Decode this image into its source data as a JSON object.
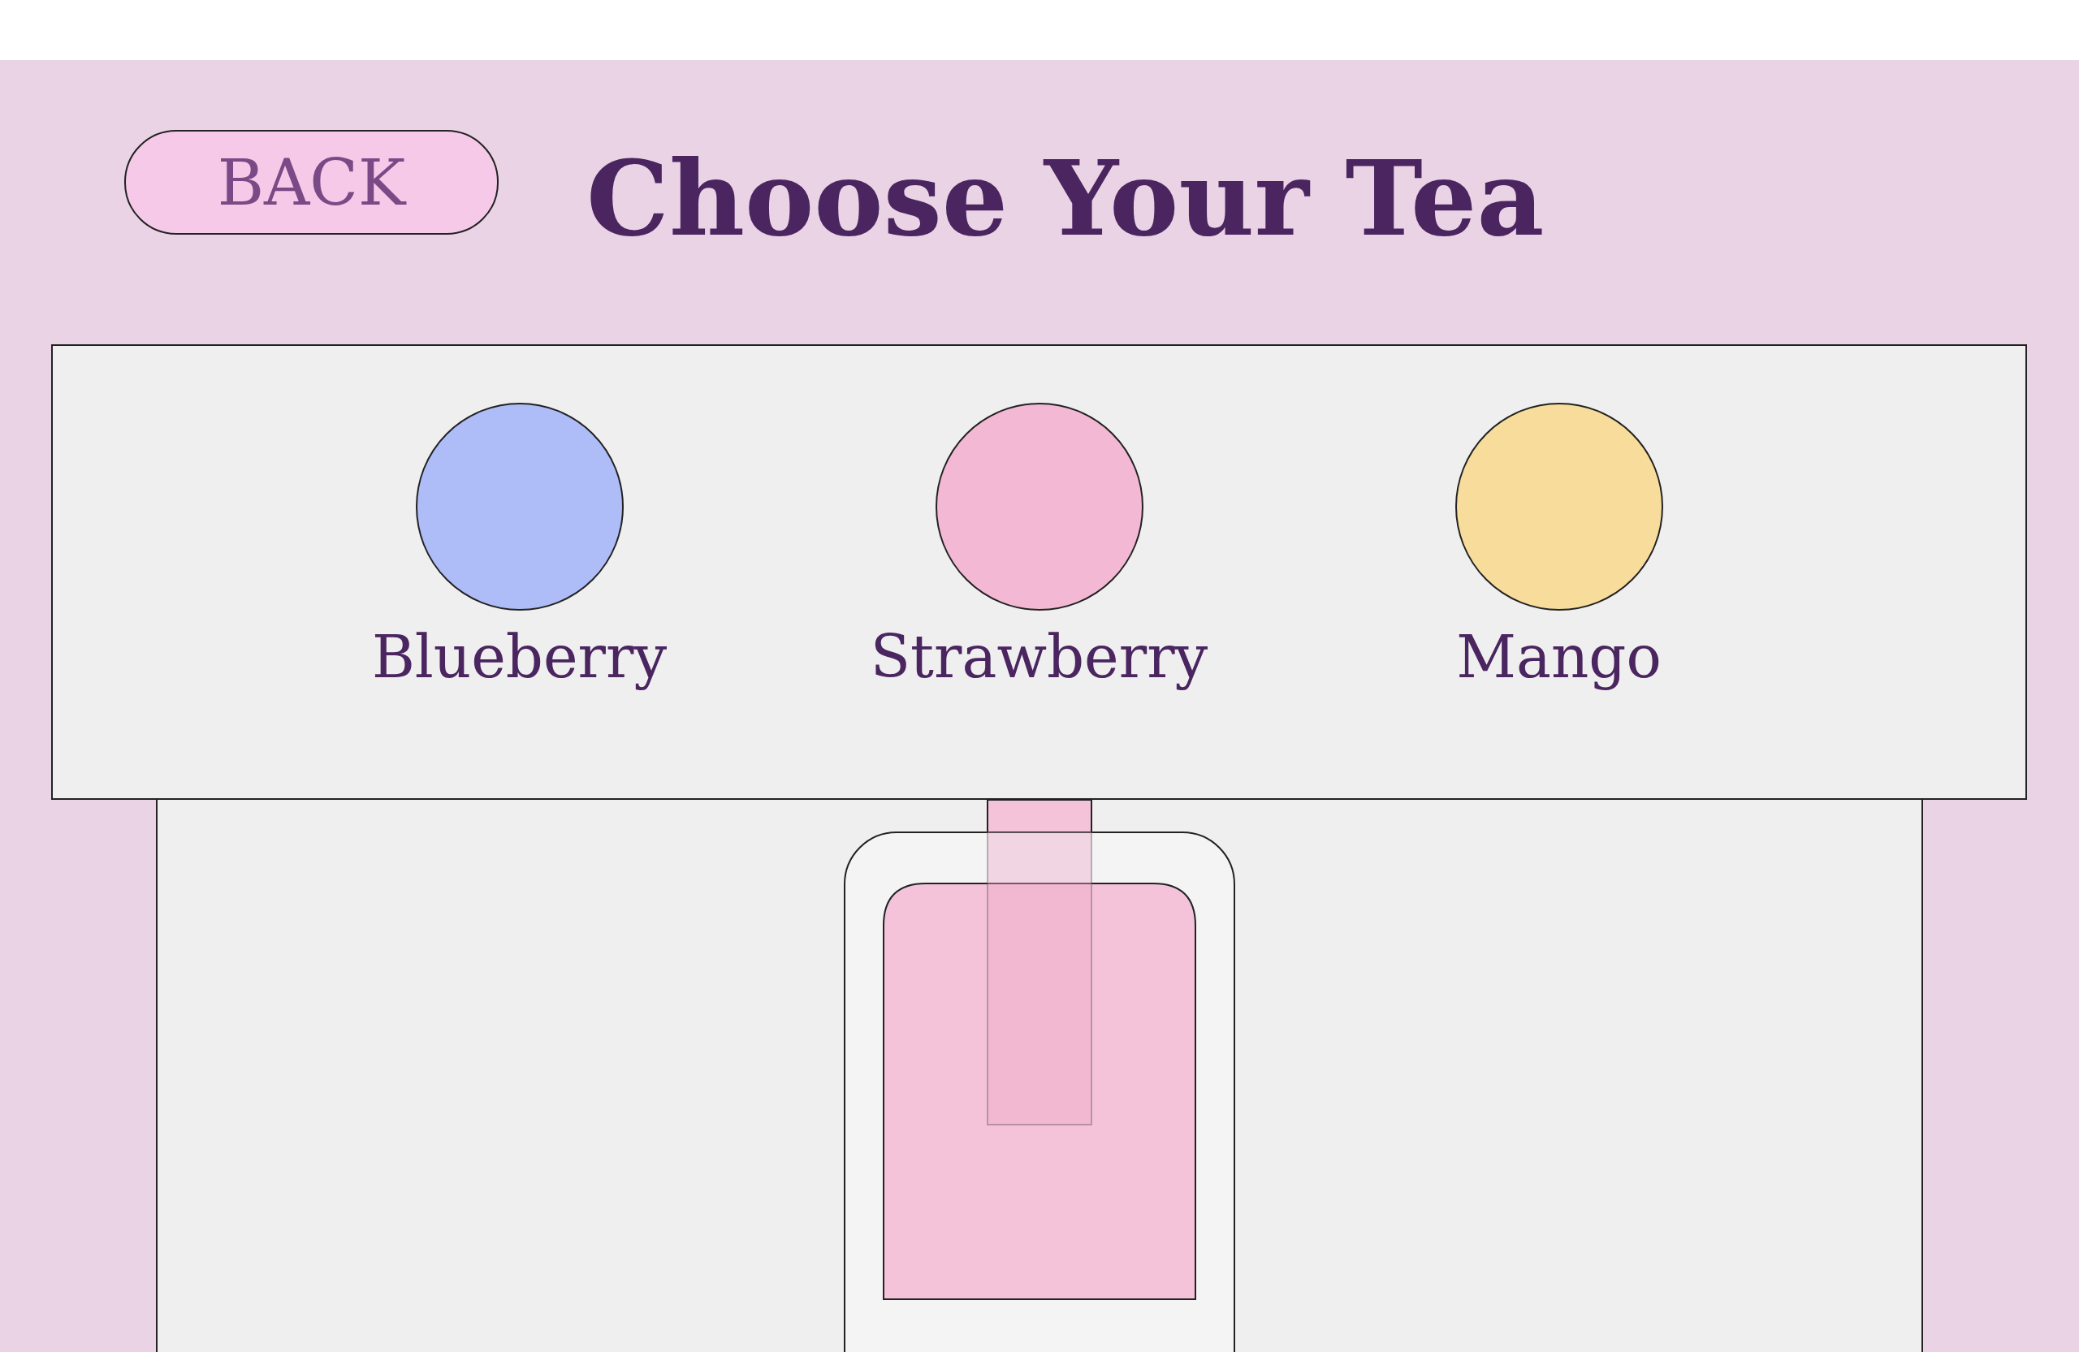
{
  "back_button": {
    "label": "BACK"
  },
  "title": "Choose Your Tea",
  "flavors": [
    {
      "name": "Blueberry",
      "color": "#aebcf8"
    },
    {
      "name": "Strawberry",
      "color": "#f3b8d3"
    },
    {
      "name": "Mango",
      "color": "#f7dc9c"
    }
  ]
}
